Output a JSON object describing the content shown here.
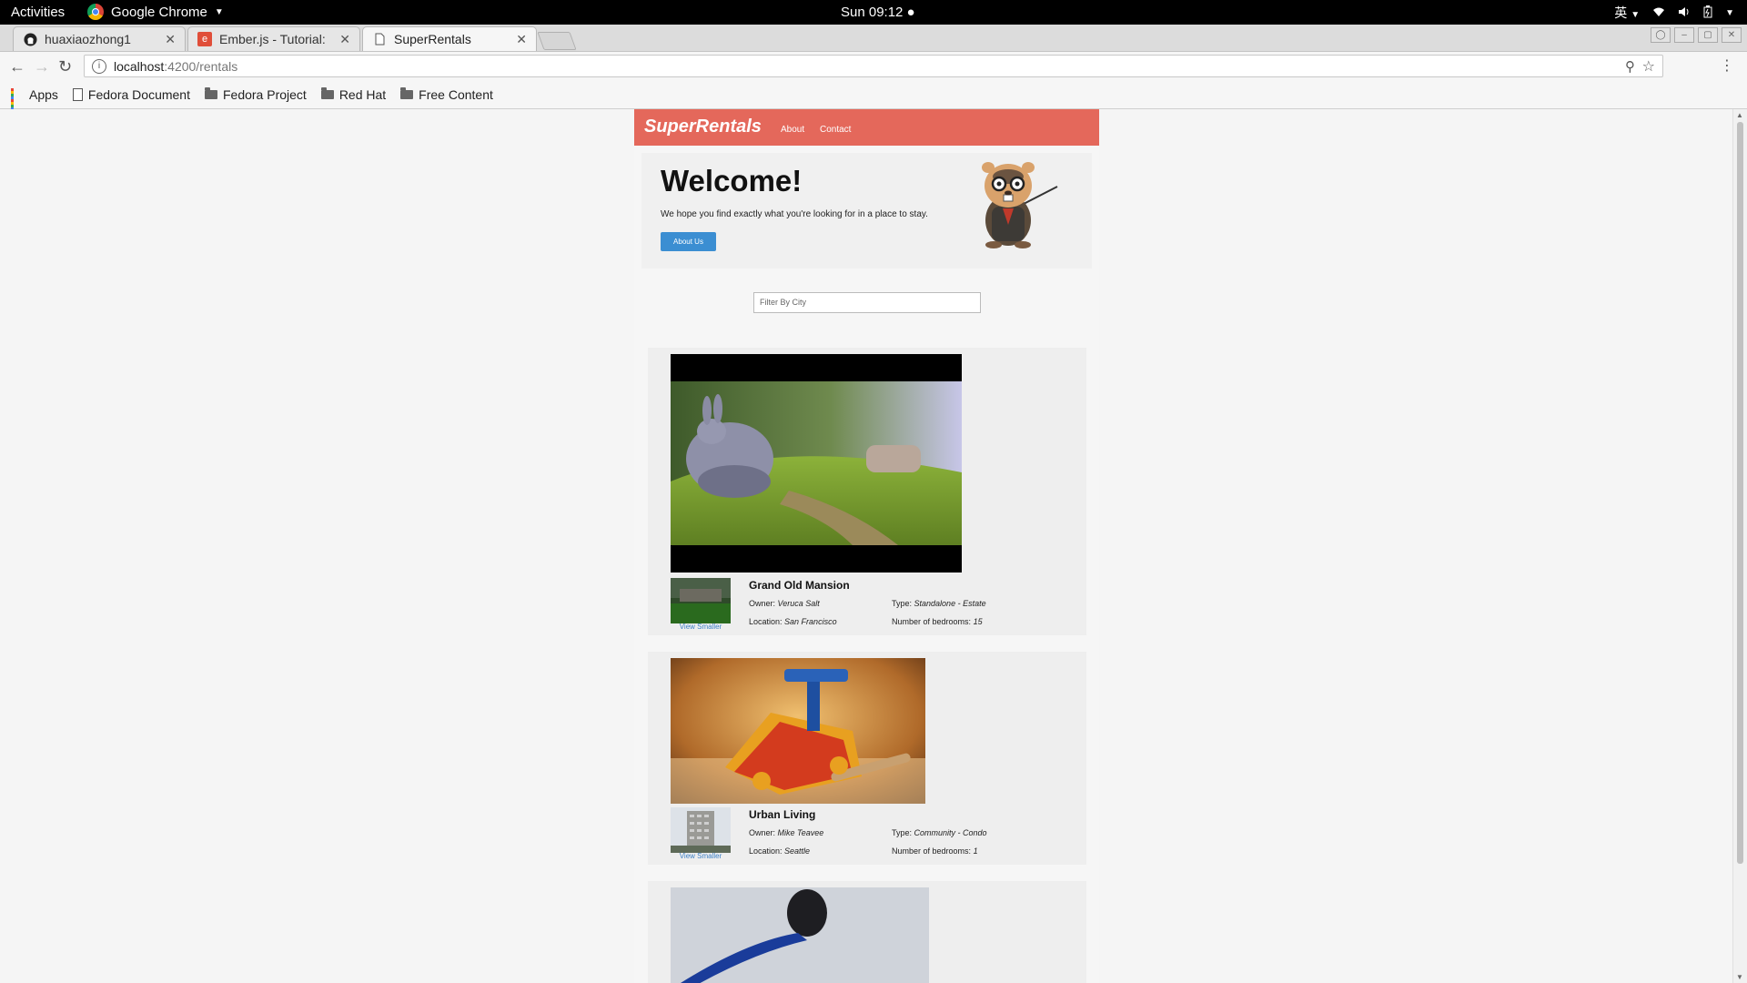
{
  "os": {
    "activities": "Activities",
    "app_name": "Google Chrome",
    "clock": "Sun 09:12 ●",
    "input_method": "英"
  },
  "browser": {
    "tabs": [
      {
        "title": "huaxiaozhong1",
        "icon": "github-icon"
      },
      {
        "title": "Ember.js - Tutorial:",
        "icon": "ember-icon"
      },
      {
        "title": "SuperRentals",
        "icon": "page-icon"
      }
    ],
    "url_host": "localhost",
    "url_path": ":4200/rentals",
    "bookmarks": [
      {
        "label": "Apps",
        "icon": "apps-grid-icon"
      },
      {
        "label": "Fedora Document",
        "icon": "page-icon"
      },
      {
        "label": "Fedora Project",
        "icon": "folder-icon"
      },
      {
        "label": "Red Hat",
        "icon": "folder-icon"
      },
      {
        "label": "Free Content",
        "icon": "folder-icon"
      }
    ]
  },
  "site": {
    "brand": "SuperRentals",
    "nav": {
      "about": "About",
      "contact": "Contact"
    },
    "header_color": "#e4685b",
    "jumbo": {
      "heading": "Welcome!",
      "lead": "We hope you find exactly what you're looking for in a place to stay.",
      "button": "About Us"
    },
    "filter_placeholder": "Filter By City",
    "rentals": [
      {
        "title": "Grand Old Mansion",
        "owner_label": "Owner:",
        "owner": "Veruca Salt",
        "type_label": "Type:",
        "type": "Standalone - Estate",
        "location_label": "Location:",
        "location": "San Francisco",
        "bedrooms_label": "Number of bedrooms:",
        "bedrooms": "15",
        "toggle": "View Smaller"
      },
      {
        "title": "Urban Living",
        "owner_label": "Owner:",
        "owner": "Mike Teavee",
        "type_label": "Type:",
        "type": "Community - Condo",
        "location_label": "Location:",
        "location": "Seattle",
        "bedrooms_label": "Number of bedrooms:",
        "bedrooms": "1",
        "toggle": "View Smaller"
      }
    ]
  }
}
